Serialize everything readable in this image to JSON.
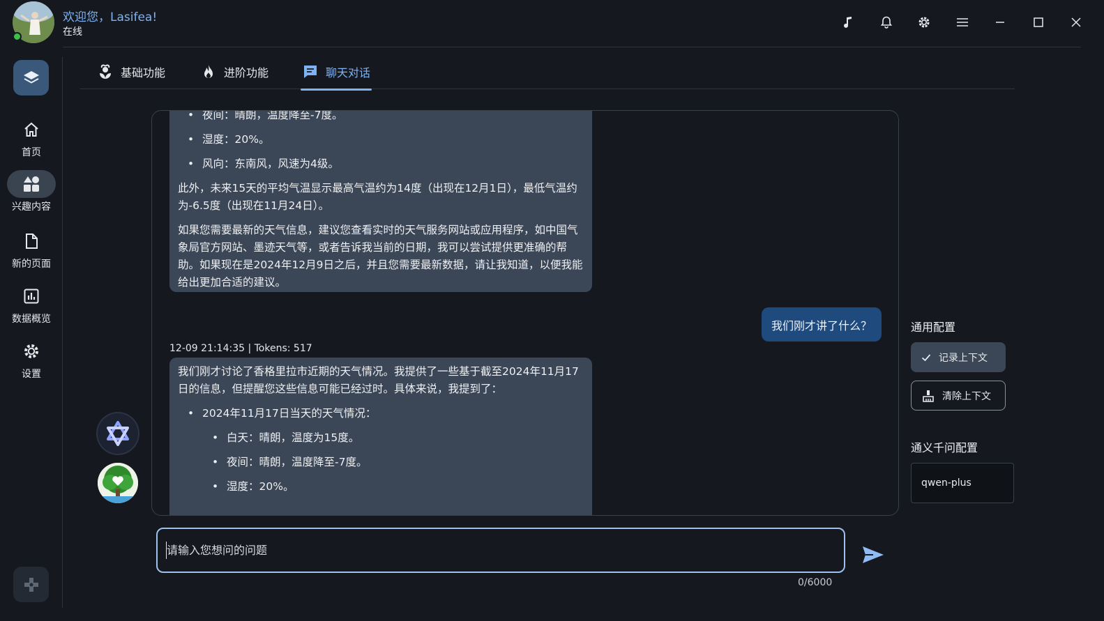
{
  "header": {
    "welcome": "欢迎您，Lasifea!",
    "status": "在线",
    "icons": [
      "music-note-icon",
      "bell-icon",
      "gear-icon",
      "menu-icon",
      "minimize-icon",
      "maximize-icon",
      "close-icon"
    ]
  },
  "sidebar": {
    "items": [
      {
        "label": "首页",
        "icon": "home-icon"
      },
      {
        "label": "兴趣内容",
        "icon": "interest-shapes-icon",
        "active": true
      },
      {
        "label": "新的页面",
        "icon": "document-icon"
      },
      {
        "label": "数据概览",
        "icon": "bar-chart-icon"
      },
      {
        "label": "设置",
        "icon": "gear-icon"
      }
    ]
  },
  "tabs": [
    {
      "label": "基础功能",
      "icon": "plant-icon"
    },
    {
      "label": "进阶功能",
      "icon": "flame-icon"
    },
    {
      "label": "聊天对话",
      "icon": "chat-icon",
      "active": true
    }
  ],
  "chat": {
    "msg1": {
      "partial_top": "夜间：晴朗，温度降至-7度。",
      "bullets": [
        "湿度：20%。",
        "风向：东南风，风速为4级。"
      ],
      "p1": "此外，未来15天的平均气温显示最高气温约为14度（出现在12月1日），最低气温约为-6.5度（出现在11月24日）。",
      "p2": "如果您需要最新的天气信息，建议您查看实时的天气服务网站或应用程序，如中国气象局官方网站、墨迹天气等，或者告诉我当前的日期，我可以尝试提供更准确的帮助。如果现在是2024年12月9日之后，并且您需要最新数据，请让我知道，以便我能给出更加合适的建议。"
    },
    "user_msg": "我们刚才讲了什么？",
    "meta": "12-09 21:14:35 | Tokens: 517",
    "msg2": {
      "p1": "我们刚才讨论了香格里拉市近期的天气情况。我提供了一些基于截至2024年11月17日的信息，但提醒您这些信息可能已经过时。具体来说，我提到了：",
      "bullet": "2024年11月17日当天的天气情况：",
      "sub": [
        "白天：晴朗，温度为15度。",
        "夜间：晴朗，温度降至-7度。",
        "湿度：20%。"
      ]
    }
  },
  "panel": {
    "general_title": "通用配置",
    "record_label": "记录上下文",
    "clear_label": "清除上下文",
    "qwen_title": "通义千问配置",
    "model": "qwen-plus"
  },
  "input": {
    "placeholder": "请输入您想问的问题",
    "counter": "0/6000"
  },
  "colors": {
    "background": "#15191f",
    "accent": "#7fb2f0",
    "bubble": "#3b4656",
    "user_bubble": "#1f4a7d",
    "online": "#3fbf4a"
  }
}
